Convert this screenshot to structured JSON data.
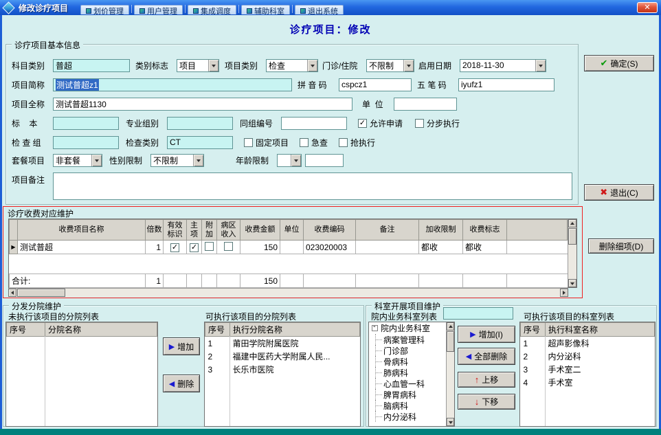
{
  "icons": {
    "close": "✕",
    "check": "✓",
    "confirm": "✔",
    "exit": "✖",
    "add_arrow": "▶",
    "remove_arrow": "◀",
    "up_arrow": "↑",
    "down_arrow": "↓",
    "row_indicator": "▶"
  },
  "window": {
    "title": "修改诊疗项目"
  },
  "background_toolbar": {
    "items": [
      "划价管理",
      "用户管理",
      "集成调度",
      "辅助科室",
      "退出系统"
    ]
  },
  "page": {
    "title": "诊疗项目：修改"
  },
  "basic": {
    "group_title": "诊疗项目基本信息",
    "subject_category_label": "科目类别",
    "subject_category_value": "普超",
    "category_flag_label": "类别标志",
    "category_flag_value": "项目",
    "item_category_label": "项目类别",
    "item_category_value": "检查",
    "visit_type_label": "门诊/住院",
    "visit_type_value": "不限制",
    "start_date_label": "启用日期",
    "start_date_value": "2018-11-30",
    "short_name_label": "项目简称",
    "short_name_value": "测试普超z1",
    "pinyin_label": "拼 音 码",
    "pinyin_value": "cspcz1",
    "wubi_label": "五 笔 码",
    "wubi_value": "iyufz1",
    "full_name_label": "项目全称",
    "full_name_value": "测试普超1130",
    "unit_label": "单  位",
    "unit_value": "",
    "specimen_label": "标    本",
    "specimen_value": "",
    "prof_group_label": "专业组别",
    "prof_group_value": "",
    "group_no_label": "同组编号",
    "group_no_value": "",
    "allow_apply_label": "允许申请",
    "step_exec_label": "分步执行",
    "check_group_label": "检 查 组",
    "check_group_value": "",
    "check_category_label": "检查类别",
    "check_category_value": "CT",
    "fixed_item_label": "固定项目",
    "urgent_label": "急查",
    "rush_label": "抢执行",
    "package_label": "套餐项目",
    "package_value": "非套餐",
    "gender_label": "性别限制",
    "gender_value": "不限制",
    "age_label": "年龄限制",
    "age_unit_value": "",
    "age_value": "",
    "remark_label": "项目备注",
    "remark_value": "",
    "confirm_label": "确定(S)",
    "exit_label": "退出(C)"
  },
  "charge": {
    "title": "诊疗收费对应维护",
    "columns": [
      "收费项目名称",
      "倍数",
      "有效标识",
      "主项",
      "附加",
      "病区收入",
      "收费金额",
      "单位",
      "收费编码",
      "备注",
      "加收限制",
      "收费标志"
    ],
    "row": {
      "name": "测试普超",
      "multiple": "1",
      "valid": true,
      "main": true,
      "attach": false,
      "ward": false,
      "amount": "150",
      "unit": "",
      "code": "023020003",
      "remark": "",
      "surcharge": "都收",
      "flag": "都收"
    },
    "total_label": "合计:",
    "total_multiple": "1",
    "total_amount": "150",
    "delete_button": "删除细项(D)"
  },
  "branch": {
    "group_title": "分发分院维护",
    "left_label": "未执行该项目的分院列表",
    "left_columns": [
      "序号",
      "分院名称"
    ],
    "left_rows": [],
    "add_button": "增加",
    "remove_button": "删除",
    "right_label": "可执行该项目的分院列表",
    "right_columns": [
      "序号",
      "执行分院名称"
    ],
    "right_rows": [
      [
        "1",
        "莆田学院附属医院"
      ],
      [
        "2",
        "福建中医药大学附属人民..."
      ],
      [
        "3",
        "长乐市医院"
      ]
    ]
  },
  "dept": {
    "group_title": "科室开展项目维护",
    "list_label": "院内业务科室列表",
    "search_value": "",
    "tree_root": "院内业务科室",
    "tree_items": [
      "病案管理科",
      "门诊部",
      "骨病科",
      "肺病科",
      "心血管一科",
      "脾胃病科",
      "脑病科",
      "内分泌科"
    ],
    "add_button": "增加(I)",
    "delete_all_button": "全部删除",
    "up_button": "上移",
    "down_button": "下移",
    "right_label": "可执行该项目的科室列表",
    "right_columns": [
      "序号",
      "执行科室名称"
    ],
    "right_rows": [
      [
        "1",
        "超声影像科"
      ],
      [
        "2",
        "内分泌科"
      ],
      [
        "3",
        "手术室二"
      ],
      [
        "4",
        "手术室"
      ]
    ]
  }
}
